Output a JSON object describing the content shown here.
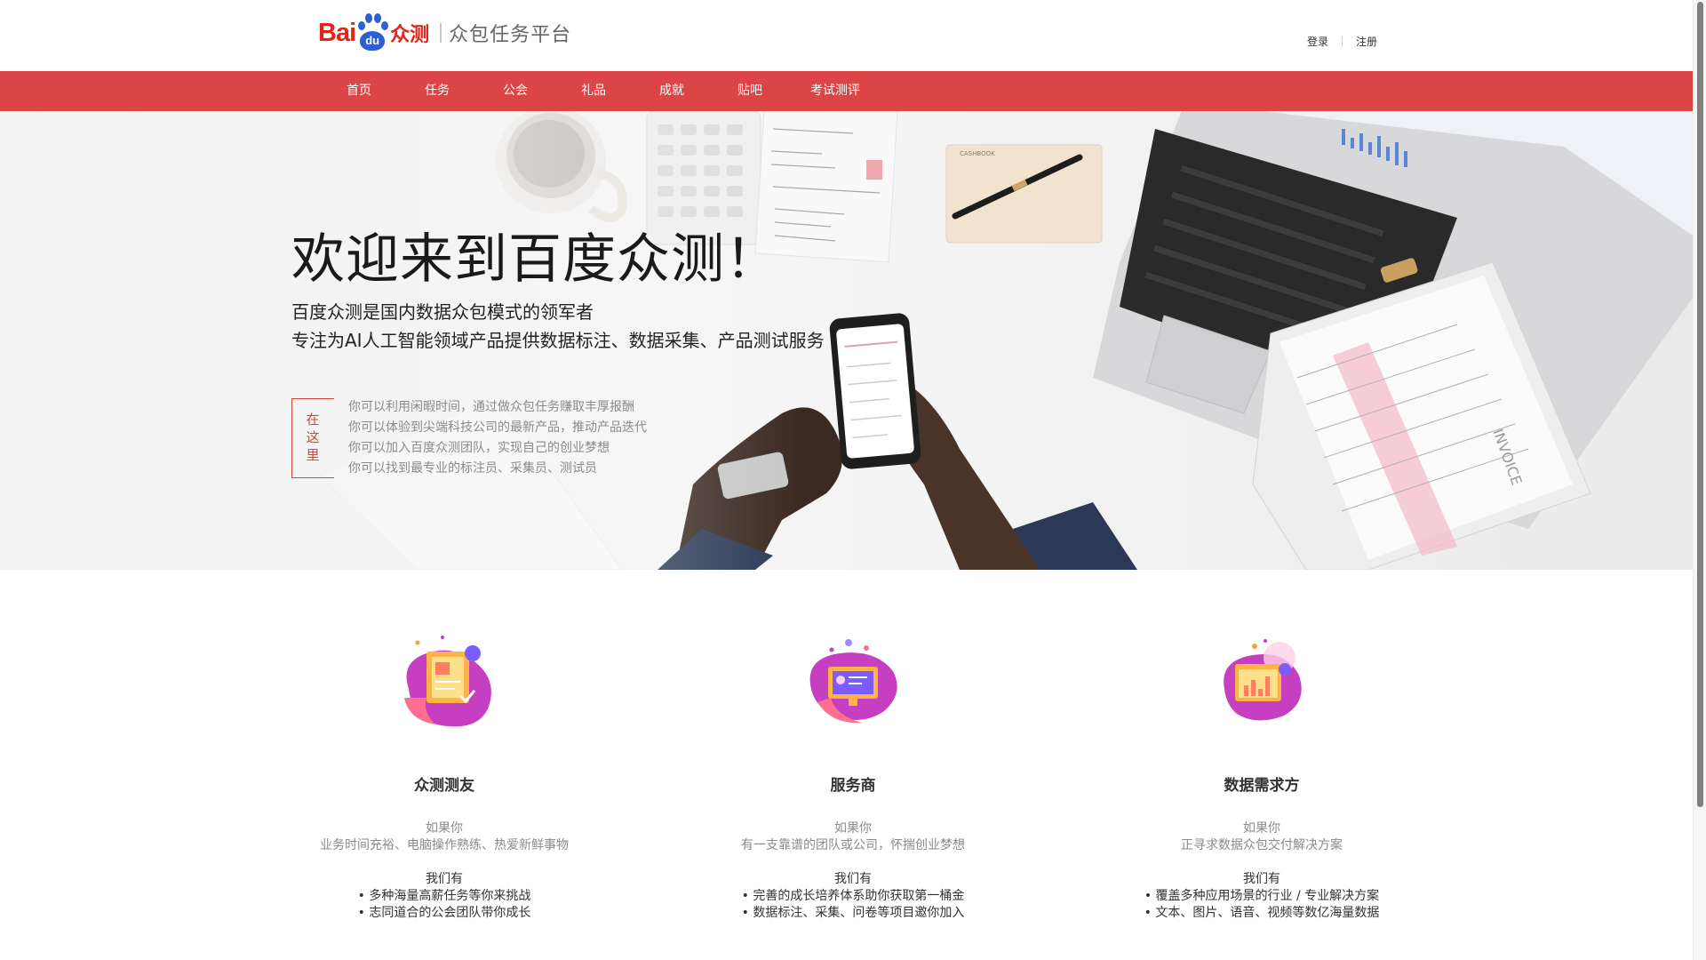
{
  "header": {
    "logo": {
      "bai": "Bai",
      "du": "du",
      "zc": "众测",
      "subtitle": "众包任务平台"
    },
    "login": "登录",
    "register": "注册"
  },
  "nav": {
    "items": [
      {
        "label": "首页"
      },
      {
        "label": "任务"
      },
      {
        "label": "公会"
      },
      {
        "label": "礼品"
      },
      {
        "label": "成就"
      },
      {
        "label": "贴吧"
      },
      {
        "label": "考试测评"
      }
    ]
  },
  "hero": {
    "title": "欢迎来到百度众测！",
    "subtitle_line1": "百度众测是国内数据众包模式的领军者",
    "subtitle_line2": "专注为AI人工智能领域产品提供数据标注、数据采集、产品测试服务",
    "here_label": [
      "在",
      "这",
      "里"
    ],
    "list": [
      "你可以利用闲暇时间，通过做众包任务赚取丰厚报酬",
      "你可以体验到尖端科技公司的最新产品，推动产品迭代",
      "你可以加入百度众测团队，实现自己的创业梦想",
      "你可以找到最专业的标注员、采集员、测试员"
    ],
    "scene_text": {
      "cashbook": "CASHBOOK",
      "invoice": "INVOICE"
    }
  },
  "features": [
    {
      "title": "众测测友",
      "if_label": "如果你",
      "if_text": "业务时间充裕、电脑操作熟练、热爱新鲜事物",
      "we_have_label": "我们有",
      "bullets": [
        "• 多种海量高薪任务等你来挑战",
        "• 志同道合的公会团队带你成长"
      ]
    },
    {
      "title": "服务商",
      "if_label": "如果你",
      "if_text": "有一支靠谱的团队或公司，怀揣创业梦想",
      "we_have_label": "我们有",
      "bullets": [
        "• 完善的成长培养体系助你获取第一桶金",
        "• 数据标注、采集、问卷等项目邀你加入"
      ]
    },
    {
      "title": "数据需求方",
      "if_label": "如果你",
      "if_text": "正寻求数据众包交付解决方案",
      "we_have_label": "我们有",
      "bullets": [
        "• 覆盖多种应用场景的行业 / 专业解决方案",
        "• 文本、图片、语音、视频等数亿海量数据"
      ]
    }
  ],
  "colors": {
    "brand_red": "#e2231a",
    "nav_red": "#dd4445",
    "baidu_blue": "#2d5fd3"
  }
}
